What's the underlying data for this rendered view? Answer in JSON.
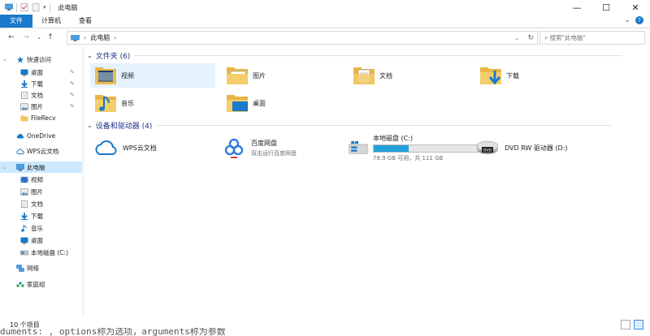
{
  "window": {
    "title": "此电脑",
    "controls": {
      "minimize": "—",
      "maximize": "☐",
      "close": "✕"
    }
  },
  "ribbon": {
    "tabs": [
      "文件",
      "计算机",
      "查看"
    ],
    "active_color": "#1979ca"
  },
  "address": {
    "crumb": "此电脑",
    "search_placeholder": "搜索\"此电脑\""
  },
  "nav": {
    "quick_access": "快速访问",
    "quick_items": [
      "桌面",
      "下载",
      "文档",
      "图片",
      "FileRecv"
    ],
    "onedrive": "OneDrive",
    "wps": "WPS云文档",
    "this_pc": "此电脑",
    "pc_items": [
      "视频",
      "图片",
      "文档",
      "下载",
      "音乐",
      "桌面",
      "本地磁盘 (C:)"
    ],
    "network": "网络",
    "homegroup": "家庭组"
  },
  "content": {
    "folders_header": "文件夹 (6)",
    "folders": [
      "视频",
      "图片",
      "文档",
      "下载",
      "音乐",
      "桌面"
    ],
    "devices_header": "设备和驱动器 (4)",
    "devices": {
      "wps": "WPS云文档",
      "baidu_name": "百度网盘",
      "baidu_sub": "双击运行百度网盘",
      "disk_name": "本地磁盘 (C:)",
      "disk_sub": "78.9 GB 可用，共 111 GB",
      "disk_free_gb": 78.9,
      "disk_total_gb": 111,
      "dvd": "DVD RW 驱动器 (D:)"
    }
  },
  "status": {
    "count": "10 个项目"
  },
  "behind_text": "duments: , options称为选项，arguments称为参数"
}
